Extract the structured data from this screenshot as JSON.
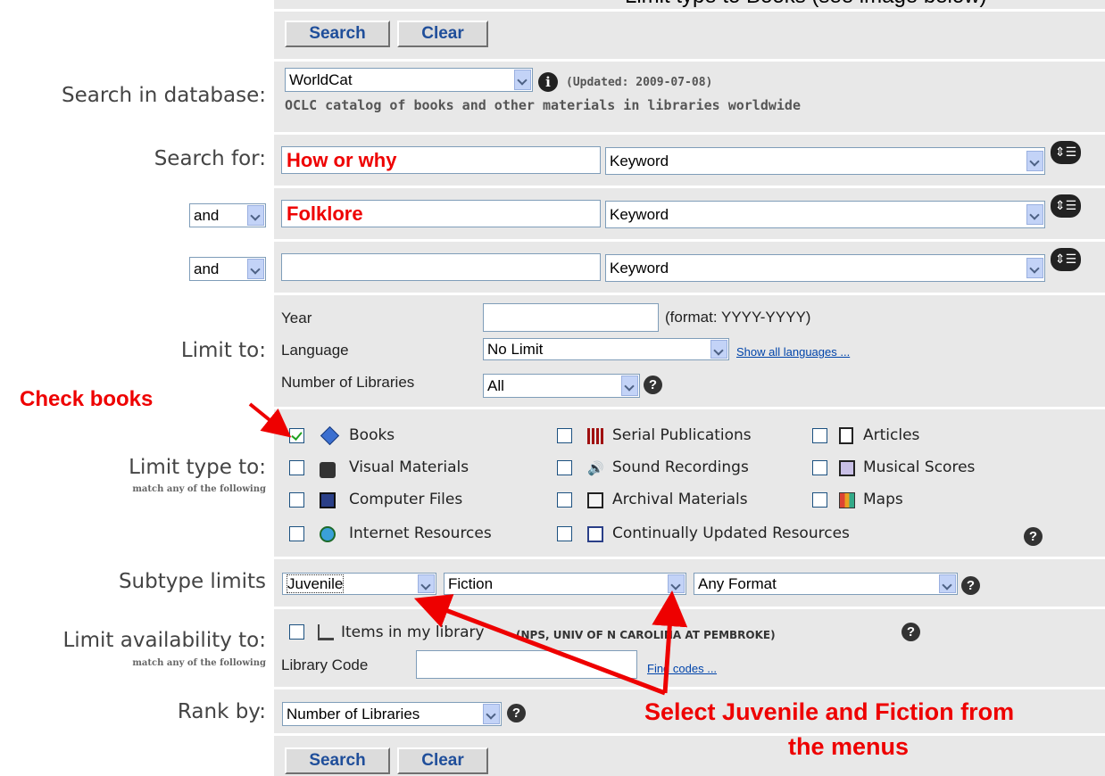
{
  "top_caption": "Limit type to Books (see image below)",
  "buttons": {
    "search": "Search",
    "clear": "Clear"
  },
  "database": {
    "label": "Search in database:",
    "selected": "WorldCat",
    "updated": "(Updated: 2009-07-08)",
    "description": "OCLC catalog of books and other materials in libraries worldwide"
  },
  "search_rows": [
    {
      "label": "Search for:",
      "operator": "",
      "term": "How or why",
      "index": "Keyword"
    },
    {
      "label": "",
      "operator": "and",
      "term": "Folklore",
      "index": "Keyword"
    },
    {
      "label": "",
      "operator": "and",
      "term": "",
      "index": "Keyword"
    }
  ],
  "limits": {
    "label": "Limit to:",
    "year_label": "Year",
    "year_value": "",
    "year_format": "(format: YYYY-YYYY)",
    "language_label": "Language",
    "language_value": "No Limit",
    "show_all_languages": "Show all languages ...",
    "libraries_label": "Number of Libraries",
    "libraries_value": "All"
  },
  "limit_type": {
    "label": "Limit type to:",
    "sublabel": "match any of the following",
    "items": [
      {
        "label": "Books",
        "checked": true,
        "icon": "book-icon"
      },
      {
        "label": "Serial Publications",
        "checked": false,
        "icon": "serial-icon"
      },
      {
        "label": "Articles",
        "checked": false,
        "icon": "article-icon"
      },
      {
        "label": "Visual Materials",
        "checked": false,
        "icon": "camera-icon"
      },
      {
        "label": "Sound Recordings",
        "checked": false,
        "icon": "speaker-icon"
      },
      {
        "label": "Musical Scores",
        "checked": false,
        "icon": "score-icon"
      },
      {
        "label": "Computer Files",
        "checked": false,
        "icon": "floppy-icon"
      },
      {
        "label": "Archival Materials",
        "checked": false,
        "icon": "archive-icon"
      },
      {
        "label": "Maps",
        "checked": false,
        "icon": "map-icon"
      },
      {
        "label": "Internet Resources",
        "checked": false,
        "icon": "globe-icon"
      },
      {
        "label": "Continually Updated Resources",
        "checked": false,
        "icon": "update-icon"
      }
    ]
  },
  "subtype": {
    "label": "Subtype limits",
    "audience": "Juvenile",
    "content": "Fiction",
    "format": "Any Format"
  },
  "availability": {
    "label": "Limit availability to:",
    "sublabel": "match any of the following",
    "items_label": "Items in my library",
    "library_name": "(NPS, UNIV OF N CAROLINA AT PEMBROKE)",
    "code_label": "Library Code",
    "code_value": "",
    "find_codes": "Find codes ..."
  },
  "rank": {
    "label": "Rank by:",
    "value": "Number of Libraries"
  },
  "annotations": {
    "check_books": "Check books",
    "select_line1": "Select Juvenile and Fiction from",
    "select_line2": "the menus"
  },
  "colors": {
    "annotation": "#ee0000",
    "panel": "#e8e8e8",
    "button_text": "#1f4e9a"
  }
}
